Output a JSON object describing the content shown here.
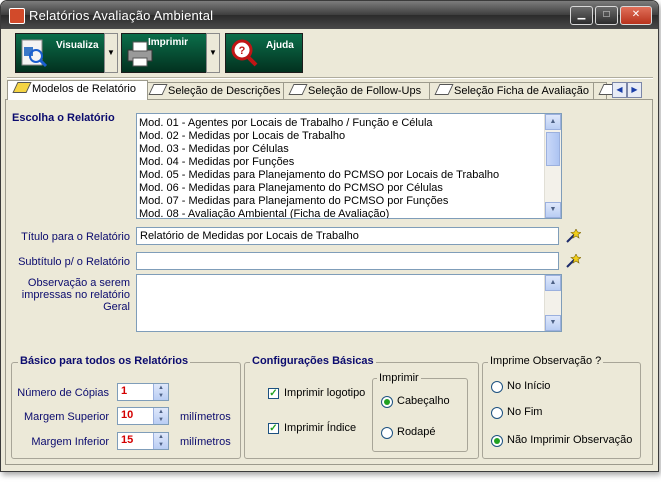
{
  "window": {
    "title": "Relatórios Avaliação Ambiental"
  },
  "toolbar": {
    "visualiza_label": "Visualiza",
    "imprimir_label": "Imprimir",
    "ajuda_label": "Ajuda"
  },
  "tabs": [
    {
      "label": "Modelos de Relatório"
    },
    {
      "label": "Seleção de Descrições"
    },
    {
      "label": "Seleção de Follow-Ups"
    },
    {
      "label": "Seleção Ficha de Avaliação"
    }
  ],
  "report": {
    "choose_label": "Escolha o Relatório",
    "items": [
      "Mod. 01 - Agentes por Locais de Trabalho / Função e Célula",
      "Mod. 02 - Medidas por Locais de Trabalho",
      "Mod. 03 - Medidas por Células",
      "Mod. 04 - Medidas por Funções",
      "Mod. 05 - Medidas para Planejamento do PCMSO por Locais de Trabalho",
      "Mod. 06 - Medidas para Planejamento do PCMSO por Células",
      "Mod. 07 - Medidas para Planejamento do PCMSO por Funções",
      "Mod. 08 - Avaliação Ambiental (Ficha de Avaliação)"
    ],
    "title_label": "Título para o Relatório",
    "title_value": "Relatório de Medidas por Locais de Trabalho",
    "subtitle_label": "Subtítulo p/ o Relatório",
    "subtitle_value": "",
    "obs_label": "Observação a serem impressas no relatório Geral",
    "obs_value": ""
  },
  "basic": {
    "title": "Básico para todos os Relatórios",
    "copies_label": "Número de Cópias",
    "copies_value": "1",
    "top_margin_label": "Margem Superior",
    "top_margin_value": "10",
    "bottom_margin_label": "Margem Inferior",
    "bottom_margin_value": "15",
    "unit": "milímetros"
  },
  "config": {
    "title": "Configurações Básicas",
    "print_logo_label": "Imprimir logotipo",
    "print_logo_checked": true,
    "print_index_label": "Imprimir Índice",
    "print_index_checked": true,
    "print_group_title": "Imprimir",
    "header_label": "Cabeçalho",
    "footer_label": "Rodapé",
    "selected": "Cabeçalho"
  },
  "obs_print": {
    "title": "Imprime Observação ?",
    "start_label": "No Início",
    "end_label": "No Fim",
    "none_label": "Não Imprimir Observação",
    "selected": "Não Imprimir Observação"
  },
  "colors": {
    "toolbar_bg": "#02311f",
    "value_red": "#d40000",
    "label_navy": "#0b0b6e",
    "check_green": "#21a121"
  },
  "icons": [
    "app-icon",
    "visualiza-icon",
    "printer-icon",
    "help-magnifier-icon",
    "wand-icon"
  ]
}
